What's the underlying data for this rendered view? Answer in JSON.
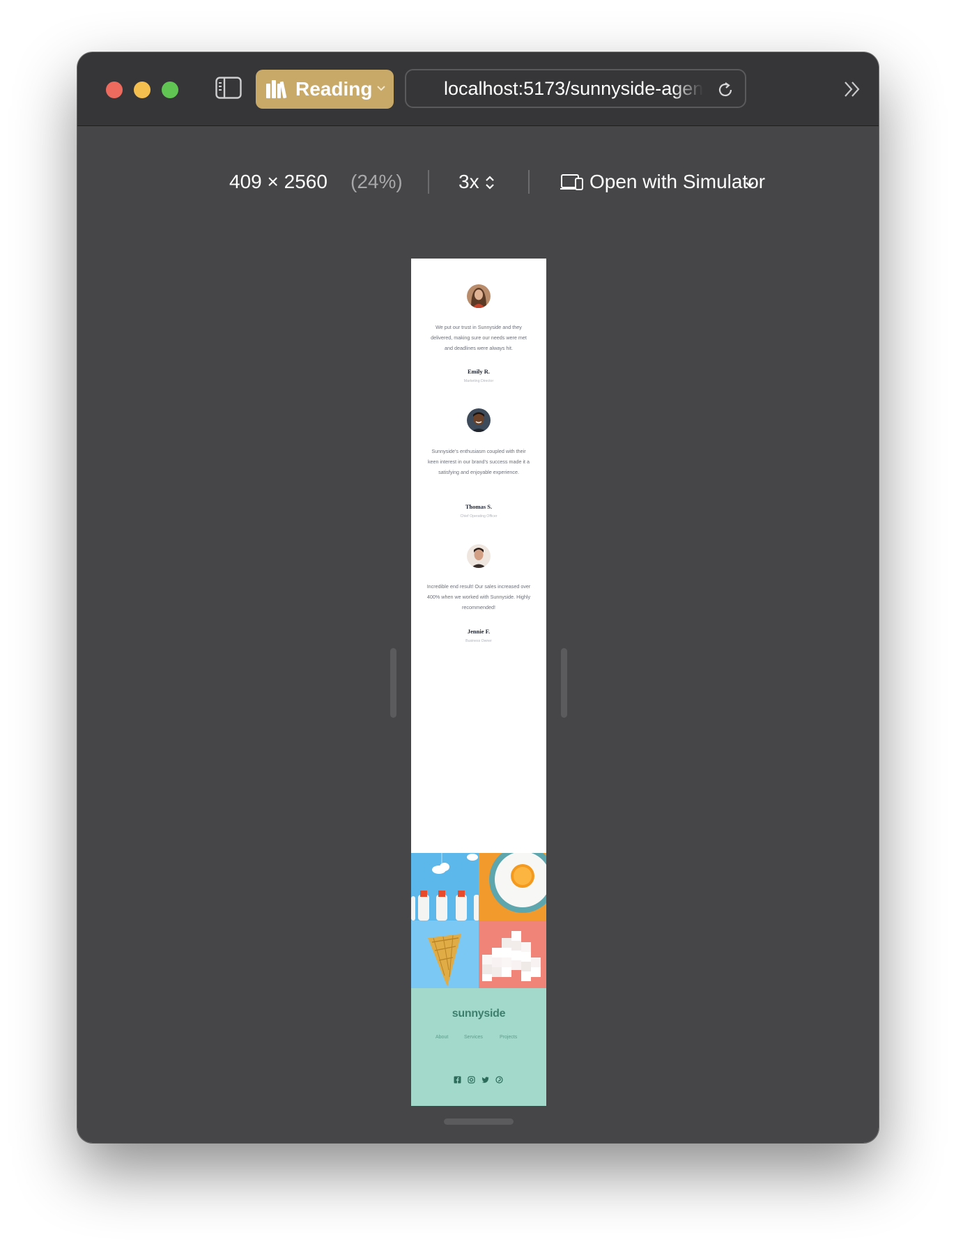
{
  "window": {
    "reading_button": {
      "label": "Reading"
    },
    "url": "localhost:5173/sunnyside-agen",
    "icons": [
      "sidebar-icon",
      "books-icon",
      "chevron-down-icon",
      "reload-icon",
      "chevron-double-right-icon"
    ]
  },
  "responsive_bar": {
    "width": "409",
    "times": "×",
    "height": "2560",
    "zoom": "(24%)",
    "scale": "3x",
    "open_with": "Open with Simulator"
  },
  "site": {
    "testimonials": [
      {
        "quote": "We put our trust in Sunnyside and they delivered, making sure our needs were met and deadlines were always hit.",
        "name": "Emily R.",
        "role": "Marketing Director"
      },
      {
        "quote": "Sunnyside’s enthusiasm coupled with their keen interest in our brand’s success made it a satisfying and enjoyable experience.",
        "name": "Thomas S.",
        "role": "Chief Operating Officer"
      },
      {
        "quote": "Incredible end result! Our sales increased over 400% when we worked with Sunnyside. Highly recommended!",
        "name": "Jennie F.",
        "role": "Business Owner"
      }
    ],
    "gallery": [
      "milk-bottles",
      "orange",
      "cone",
      "sugar-cubes"
    ],
    "footer": {
      "logo": "sunnyside",
      "nav": [
        "About",
        "Services",
        "Projects"
      ],
      "social": [
        "facebook-icon",
        "instagram-icon",
        "twitter-icon",
        "pinterest-icon"
      ],
      "background": "#a2d9cb"
    }
  },
  "colors": {
    "window_bg": "#464648",
    "titlebar_bg": "#363638",
    "reading_accent": "#c8a968"
  }
}
